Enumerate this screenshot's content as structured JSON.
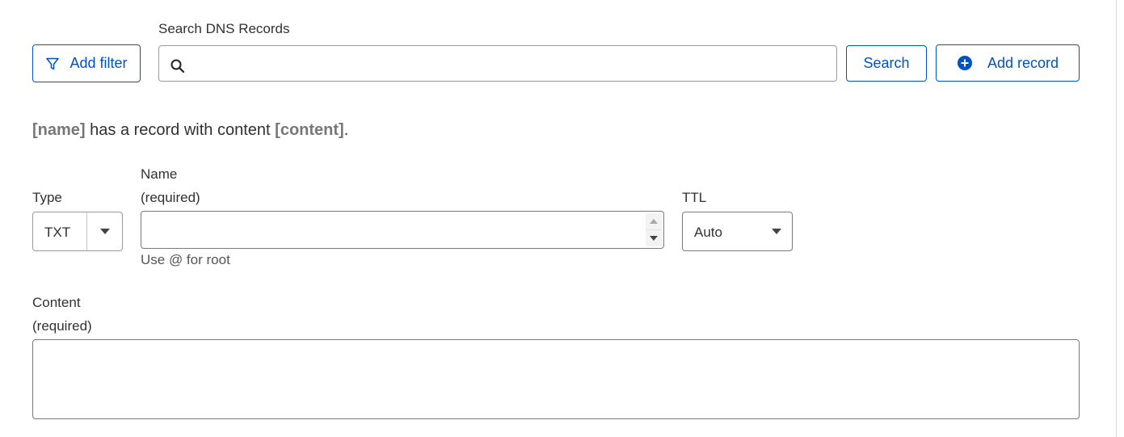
{
  "toolbar": {
    "add_filter_label": "Add filter",
    "search_label": "Search DNS Records",
    "search_value": "",
    "search_button_label": "Search",
    "add_record_label": "Add record"
  },
  "preview": {
    "name_placeholder": "[name]",
    "middle_text": " has a record with content ",
    "content_placeholder": "[content]",
    "end_text": "."
  },
  "form": {
    "type": {
      "label": "Type",
      "selected": "TXT"
    },
    "name": {
      "label": "Name",
      "required": "(required)",
      "value": "",
      "hint": "Use @ for root"
    },
    "ttl": {
      "label": "TTL",
      "selected": "Auto"
    },
    "content": {
      "label": "Content",
      "required": "(required)",
      "value": ""
    }
  },
  "colors": {
    "accent": "#0051c3",
    "border": "#9a9a9a",
    "text": "#313131",
    "placeholder_text": "#777777"
  },
  "icons": {
    "filter": "filter-icon",
    "search": "search-icon",
    "add": "plus-circle-icon",
    "caret": "caret-down-icon"
  }
}
